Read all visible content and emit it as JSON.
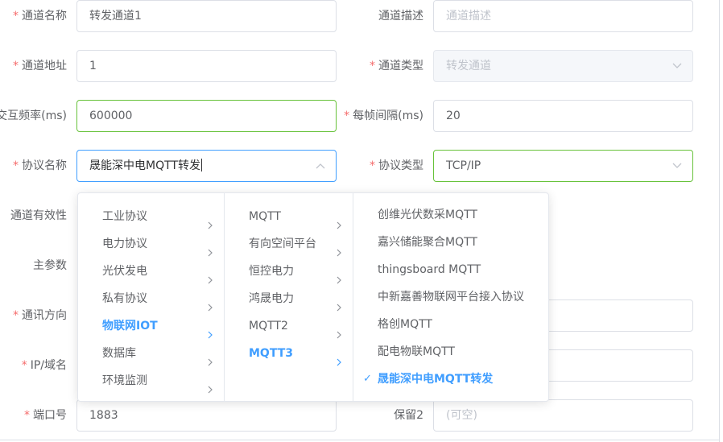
{
  "form": {
    "row1": {
      "left_label": "通道名称",
      "left_value": "转发通道1",
      "right_label": "通道描述",
      "right_placeholder": "通道描述"
    },
    "row2": {
      "left_label": "通道地址",
      "left_value": "1",
      "right_label": "通道类型",
      "right_value": "转发通道"
    },
    "row3": {
      "left_label": "交互频率(ms)",
      "left_value": "600000",
      "right_label": "每帧间隔(ms)",
      "right_value": "20"
    },
    "row4": {
      "left_label": "协议名称",
      "left_value": "晟能深中电MQTT转发",
      "right_label": "协议类型",
      "right_value": "TCP/IP"
    },
    "row5": {
      "left_label": "通道有效性"
    },
    "row6": {
      "left_label": "主参数"
    },
    "row7": {
      "left_label": "通讯方向"
    },
    "row8": {
      "left_label": "IP/域名"
    },
    "row9": {
      "left_label": "端口号",
      "left_value": "1883",
      "right_label": "保留2",
      "right_placeholder": "(可空)"
    },
    "required_mark": "*"
  },
  "cascader": {
    "level1": [
      "工业协议",
      "电力协议",
      "光伏发电",
      "私有协议",
      "物联网IOT",
      "数据库",
      "环境监测"
    ],
    "level1_active": 4,
    "level2": [
      "MQTT",
      "有向空间平台",
      "恒控电力",
      "鸿晟电力",
      "MQTT2",
      "MQTT3"
    ],
    "level2_active": 5,
    "level3": [
      "创维光伏数采MQTT",
      "嘉兴储能聚合MQTT",
      "thingsboard MQTT",
      "中新嘉善物联网平台接入协议",
      "格创MQTT",
      "配电物联MQTT",
      "晟能深中电MQTT转发"
    ],
    "level3_selected": 6,
    "check_glyph": "✓"
  },
  "colors": {
    "primary": "#409eff",
    "success_border": "#67c23a",
    "required": "#f56c6c"
  }
}
